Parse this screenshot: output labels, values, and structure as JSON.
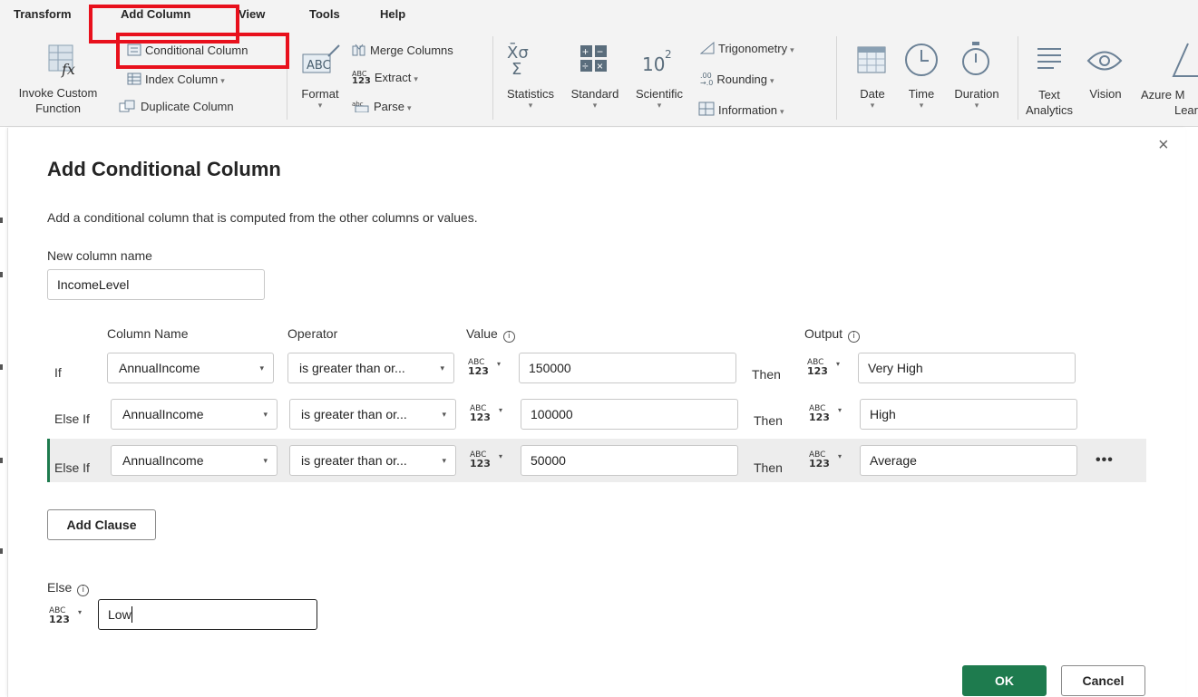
{
  "tabs": [
    "Transform",
    "Add Column",
    "View",
    "Tools",
    "Help"
  ],
  "ribbon": {
    "invoke_custom_function": [
      "Invoke Custom",
      "Function"
    ],
    "conditional_column": "Conditional Column",
    "index_column": "Index Column",
    "duplicate_column": "Duplicate Column",
    "format": "Format",
    "merge_columns": "Merge Columns",
    "extract": "Extract",
    "parse": "Parse",
    "statistics": "Statistics",
    "standard": "Standard",
    "scientific": "Scientific",
    "trigonometry": "Trigonometry",
    "rounding": "Rounding",
    "information": "Information",
    "date": "Date",
    "time": "Time",
    "duration": "Duration",
    "text_analytics": [
      "Text",
      "Analytics"
    ],
    "vision": "Vision",
    "azure_ml": [
      "Azure M",
      "Lear"
    ]
  },
  "dialog": {
    "title": "Add Conditional Column",
    "description": "Add a conditional column that is computed from the other columns or values.",
    "new_column_label": "New column name",
    "new_column_value": "IncomeLevel",
    "headers": {
      "column_name": "Column Name",
      "operator": "Operator",
      "value": "Value",
      "output": "Output"
    },
    "rows": [
      {
        "keyword": "If",
        "column": "AnnualIncome",
        "operator": "is greater than or...",
        "value": "150000",
        "then": "Then",
        "output": "Very High"
      },
      {
        "keyword": "Else If",
        "column": "AnnualIncome",
        "operator": "is greater than or...",
        "value": "100000",
        "then": "Then",
        "output": "High"
      },
      {
        "keyword": "Else If",
        "column": "AnnualIncome",
        "operator": "is greater than or...",
        "value": "50000",
        "then": "Then",
        "output": "Average"
      }
    ],
    "type_abc": "ABC",
    "type_num": "123",
    "add_clause": "Add Clause",
    "else_label": "Else",
    "else_value": "Low",
    "ok": "OK",
    "cancel": "Cancel",
    "more": "•••",
    "close": "×",
    "info_glyph": "i"
  },
  "colors": {
    "accent_green": "#1e7b4e",
    "highlight_red": "#e8101c"
  }
}
